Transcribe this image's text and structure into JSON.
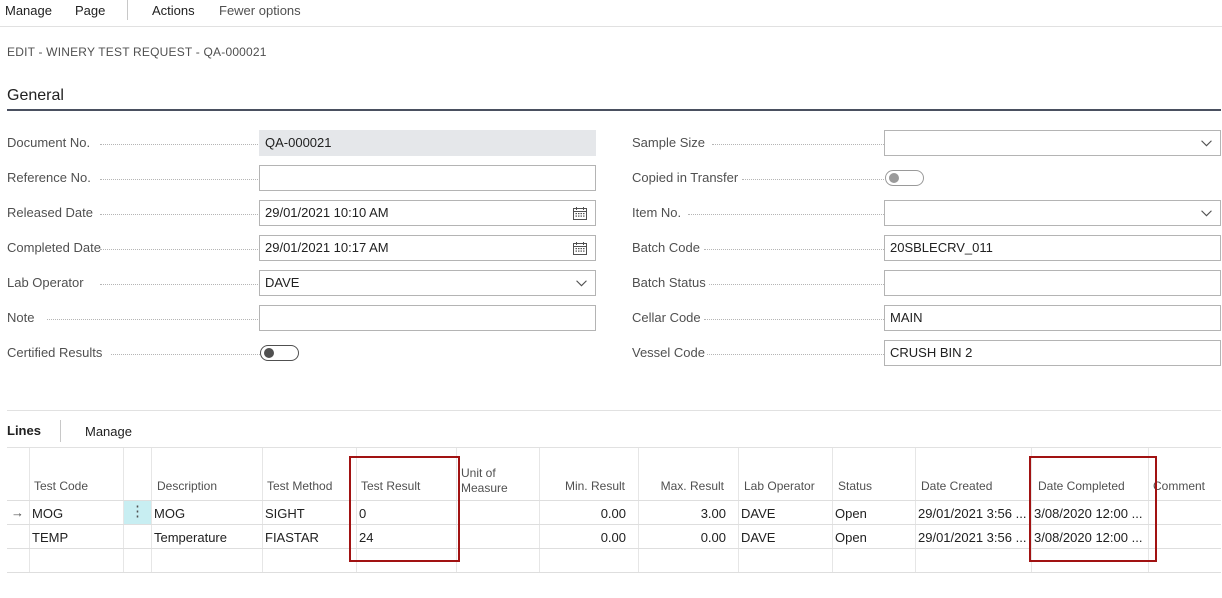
{
  "actionbar": {
    "manage": "Manage",
    "page": "Page",
    "actions": "Actions",
    "fewer_options": "Fewer options"
  },
  "page_caption": "EDIT - WINERY TEST REQUEST - QA-000021",
  "general": {
    "title": "General",
    "left": {
      "document_no": {
        "label": "Document No.",
        "value": "QA-000021"
      },
      "reference_no": {
        "label": "Reference No.",
        "value": ""
      },
      "released_date": {
        "label": "Released Date",
        "value": "29/01/2021 10:10 AM"
      },
      "completed_date": {
        "label": "Completed Date",
        "value": "29/01/2021 10:17 AM"
      },
      "lab_operator": {
        "label": "Lab Operator",
        "value": "DAVE"
      },
      "note": {
        "label": "Note",
        "value": ""
      },
      "certified_results": {
        "label": "Certified Results",
        "value": false
      }
    },
    "right": {
      "sample_size": {
        "label": "Sample Size",
        "value": ""
      },
      "copied_in_transfer": {
        "label": "Copied in Transfer",
        "value": false
      },
      "item_no": {
        "label": "Item No.",
        "value": ""
      },
      "batch_code": {
        "label": "Batch Code",
        "value": "20SBLECRV_011"
      },
      "batch_status": {
        "label": "Batch Status",
        "value": ""
      },
      "cellar_code": {
        "label": "Cellar Code",
        "value": "MAIN"
      },
      "vessel_code": {
        "label": "Vessel Code",
        "value": "CRUSH BIN 2"
      }
    }
  },
  "lines": {
    "tab": "Lines",
    "manage": "Manage",
    "headers": {
      "test_code": "Test Code",
      "description": "Description",
      "test_method": "Test Method",
      "test_result": "Test Result",
      "unit_line1": "Unit of",
      "unit_line2": "Measure",
      "min_result": "Min. Result",
      "max_result": "Max. Result",
      "lab_operator": "Lab Operator",
      "status": "Status",
      "date_created": "Date Created",
      "date_completed": "Date Completed",
      "comment": "Comment"
    },
    "rows": [
      {
        "arrow": "→",
        "test_code": "MOG",
        "description": "MOG",
        "test_method": "SIGHT",
        "test_result": "0",
        "unit": "",
        "min": "0.00",
        "max": "3.00",
        "lab_operator": "DAVE",
        "status": "Open",
        "date_created": "29/01/2021 3:56 ...",
        "date_completed": "3/08/2020 12:00 ...",
        "comment": ""
      },
      {
        "arrow": "",
        "test_code": "TEMP",
        "description": "Temperature",
        "test_method": "FIASTAR",
        "test_result": "24",
        "unit": "",
        "min": "0.00",
        "max": "0.00",
        "lab_operator": "DAVE",
        "status": "Open",
        "date_created": "29/01/2021 3:56 ...",
        "date_completed": "3/08/2020 12:00 ...",
        "comment": ""
      }
    ],
    "row_menu_glyph": "⋮"
  },
  "icons": {
    "dropdown": "chevron-down-icon",
    "calendar": "calendar-icon",
    "current_row": "row-arrow-icon"
  },
  "colors": {
    "highlight": "#a11212",
    "readonly_bg": "#e5e7ea",
    "row_menu_bg": "#c8eef2"
  }
}
